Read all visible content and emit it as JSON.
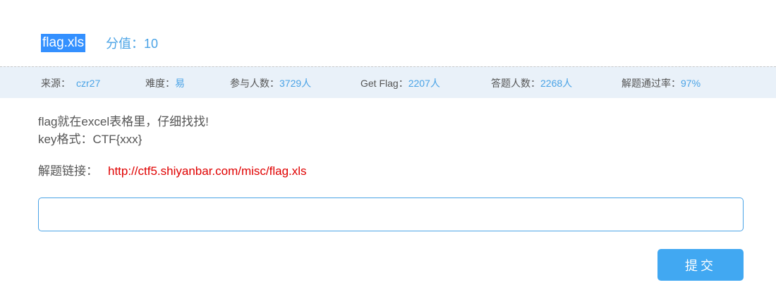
{
  "challenge": {
    "title": "flag.xls",
    "score_label": "分值：",
    "score_value": "10"
  },
  "info": {
    "source_label": "来源：",
    "source_value": "czr27",
    "difficulty_label": "难度：",
    "difficulty_value": "易",
    "participants_label": "参与人数：",
    "participants_value": "3729人",
    "getflag_label": "Get Flag：",
    "getflag_value": "2207人",
    "answered_label": "答题人数：",
    "answered_value": "2268人",
    "passrate_label": "解题通过率：",
    "passrate_value": "97%"
  },
  "description": {
    "line1": "flag就在excel表格里，仔细找找!",
    "line2": "key格式：CTF{xxx}"
  },
  "link": {
    "label": "解题链接：",
    "url": "http://ctf5.shiyanbar.com/misc/flag.xls"
  },
  "answer": {
    "value": "",
    "placeholder": ""
  },
  "submit": {
    "label": "提交"
  },
  "colors": {
    "accent": "#4aa3e6",
    "button": "#41a8f2",
    "link": "#e00000",
    "selection": "#3390ff",
    "infobar_bg": "#e9f1f9"
  }
}
